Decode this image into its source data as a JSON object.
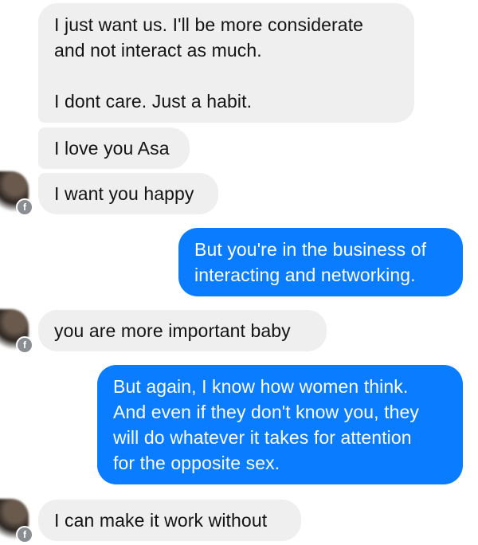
{
  "messages": [
    {
      "direction": "incoming",
      "text": "I just want us.   I'll be more considerate\nand not interact as much.\n\nI dont care.  Just a habit."
    },
    {
      "direction": "incoming",
      "text": "I love you Asa"
    },
    {
      "direction": "incoming",
      "text": "I want you happy"
    },
    {
      "direction": "outgoing",
      "text": "But you're in the business of\ninteracting and networking."
    },
    {
      "direction": "incoming",
      "text": "you are more important baby"
    },
    {
      "direction": "outgoing",
      "text": "But again, I know how women think.\nAnd even if they don't know you, they\nwill do whatever it takes for attention\nfor the opposite sex."
    },
    {
      "direction": "incoming",
      "text": "I can make it work without"
    }
  ],
  "avatar_badge_icon": "facebook-icon",
  "colors": {
    "incoming_bubble": "#efeff0",
    "outgoing_bubble": "#0a7cff",
    "incoming_text": "#141414",
    "outgoing_text": "#ffffff"
  }
}
